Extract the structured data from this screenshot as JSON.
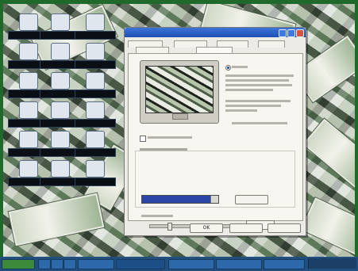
{
  "desktop": {
    "icons": [
      {
        "label": ""
      },
      {
        "label": ""
      },
      {
        "label": ""
      },
      {
        "label": ""
      },
      {
        "label": ""
      },
      {
        "label": ""
      },
      {
        "label": ""
      },
      {
        "label": ""
      },
      {
        "label": ""
      },
      {
        "label": ""
      },
      {
        "label": ""
      },
      {
        "label": ""
      },
      {
        "label": ""
      },
      {
        "label": ""
      },
      {
        "label": ""
      },
      {
        "label": ""
      },
      {
        "label": ""
      },
      {
        "label": ""
      }
    ]
  },
  "dialog": {
    "title": "",
    "tabs": [
      {
        "label": ""
      },
      {
        "label": ""
      },
      {
        "label": ""
      },
      {
        "label": ""
      },
      {
        "label": ""
      },
      {
        "label": ""
      }
    ],
    "buttons": {
      "ok": "OK",
      "cancel": "",
      "apply": "",
      "browse": "",
      "customize": ""
    }
  },
  "colors": {
    "titlebar": "#1f4fb3",
    "selection": "#2c46a8",
    "taskbar": "#214f7e",
    "desktop_border": "#1f6a2a"
  },
  "icons": [
    "minimize-icon",
    "maximize-icon",
    "close-icon",
    "monitor-icon",
    "start-icon"
  ]
}
